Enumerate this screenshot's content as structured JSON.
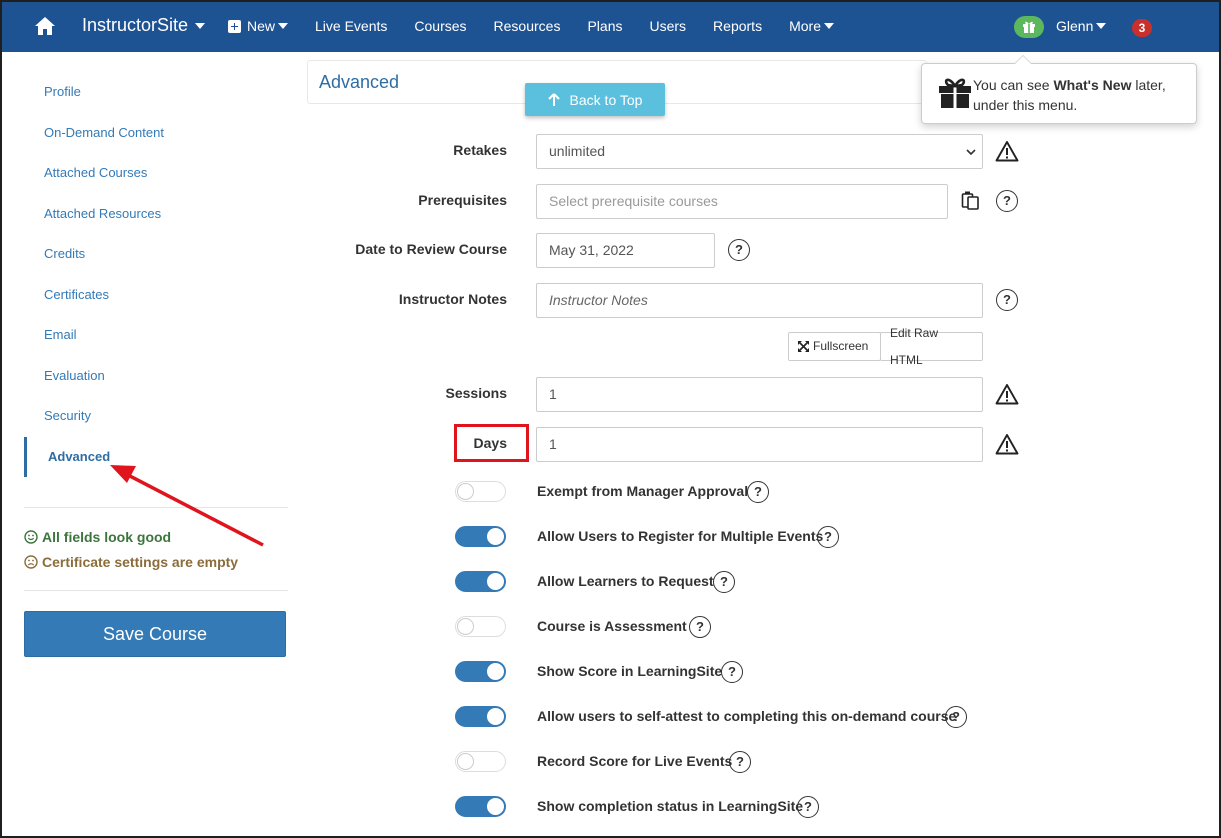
{
  "navbar": {
    "brand": "InstructorSite",
    "new_label": "New",
    "items": [
      "Live Events",
      "Courses",
      "Resources",
      "Plans",
      "Users",
      "Reports"
    ],
    "more_label": "More",
    "user": "Glenn",
    "notifications": "3",
    "colors": {
      "bar": "#1e5393",
      "gift": "#5cb85c",
      "badge": "#c9302c"
    }
  },
  "sidebar": {
    "items": [
      "Profile",
      "On-Demand Content",
      "Attached Courses",
      "Attached Resources",
      "Credits",
      "Certificates",
      "Email",
      "Evaluation",
      "Security",
      "Advanced"
    ],
    "active": "Advanced",
    "status_good": "All fields look good",
    "status_warn": "Certificate settings are empty",
    "save_label": "Save Course"
  },
  "panel": {
    "title": "Advanced"
  },
  "back_to_top": "Back to Top",
  "popover": {
    "text_a": "You can see ",
    "text_b": "What's New",
    "text_c": " later,",
    "text_d": "under this menu."
  },
  "form": {
    "retakes": {
      "label": "Retakes",
      "value": "unlimited"
    },
    "prerequisites": {
      "label": "Prerequisites",
      "placeholder": "Select prerequisite courses"
    },
    "review_date": {
      "label": "Date to Review Course",
      "value": "May 31, 2022"
    },
    "instructor_notes": {
      "label": "Instructor Notes",
      "placeholder": "Instructor Notes"
    },
    "fullscreen_label": "Fullscreen",
    "edit_raw_label": "Edit Raw HTML",
    "sessions": {
      "label": "Sessions",
      "value": "1"
    },
    "days": {
      "label": "Days",
      "value": "1"
    }
  },
  "toggles": [
    {
      "label": "Exempt from Manager Approval",
      "on": false
    },
    {
      "label": "Allow Users to Register for Multiple Events",
      "on": true
    },
    {
      "label": "Allow Learners to Request",
      "on": true
    },
    {
      "label": "Course is Assessment",
      "on": false
    },
    {
      "label": "Show Score in LearningSite",
      "on": true
    },
    {
      "label": "Allow users to self-attest to completing this on-demand course",
      "on": true
    },
    {
      "label": "Record Score for Live Events",
      "on": false
    },
    {
      "label": "Show completion status in LearningSite",
      "on": true
    }
  ],
  "help_glyph": "?"
}
